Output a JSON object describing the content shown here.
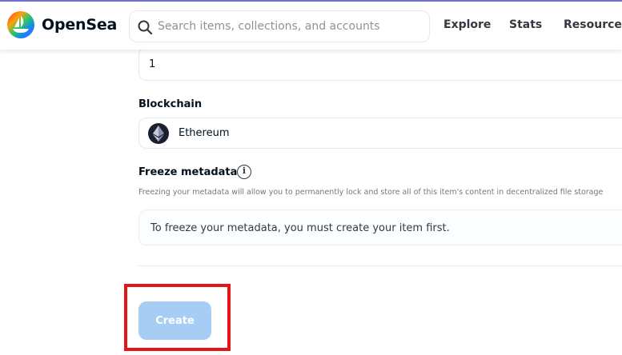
{
  "header": {
    "brand": "OpenSea",
    "logo_icon": "opensea-logo-icon",
    "search": {
      "placeholder": "Search items, collections, and accounts",
      "value": ""
    },
    "nav": [
      {
        "label": "Explore"
      },
      {
        "label": "Stats"
      },
      {
        "label": "Resources"
      }
    ]
  },
  "form": {
    "supply": {
      "value": "1"
    },
    "blockchain": {
      "label": "Blockchain",
      "value": "Ethereum",
      "icon": "ethereum-icon"
    },
    "freeze": {
      "label": "Freeze metadata",
      "info_icon": "info-icon",
      "description": "Freezing your metadata will allow you to permanently lock and store all of this item's content in decentralized file storage",
      "notice": "To freeze your metadata, you must create your item first."
    },
    "create_button": {
      "label": "Create",
      "state": "disabled"
    }
  },
  "annotation": {
    "highlight_color": "#e51515"
  },
  "colors": {
    "button_bg": "#a8cdf4",
    "text": "#04111d",
    "muted": "#707a83",
    "border": "#e5e8eb"
  }
}
